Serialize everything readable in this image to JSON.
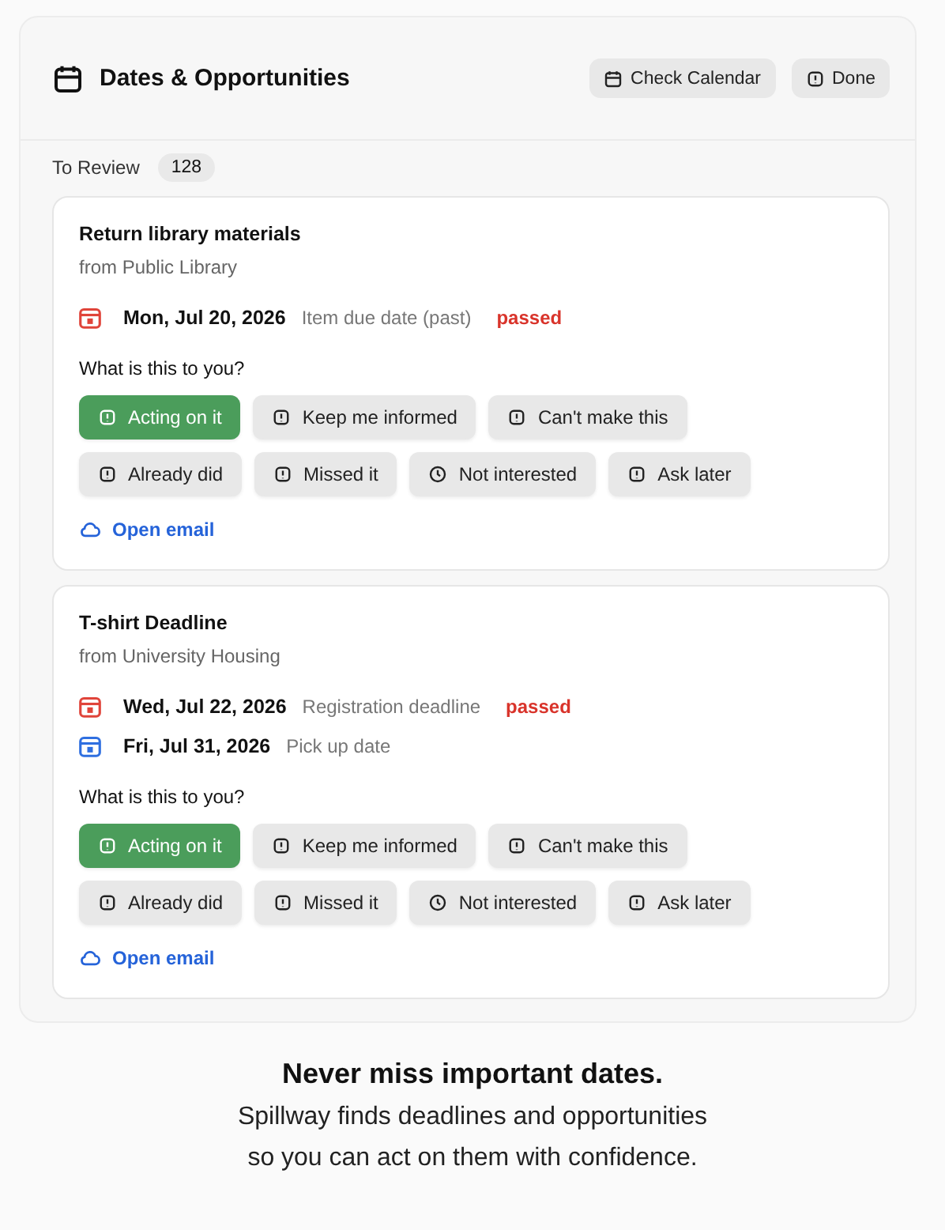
{
  "header": {
    "title": "Dates & Opportunities",
    "actions": [
      {
        "kind": "calendar",
        "label": "Check Calendar"
      },
      {
        "kind": "done",
        "label": "Done"
      }
    ]
  },
  "review": {
    "label": "To Review",
    "count": "128"
  },
  "cards": [
    {
      "title": "Return library materials",
      "source": "from Public Library",
      "dates": [
        {
          "date": "Mon, Jul 20, 2026",
          "description": "Item due date (past)",
          "status": "passed",
          "color": "#e0443a"
        }
      ],
      "question": "What is this to you?",
      "options": [
        {
          "label": "Acting on it",
          "selected": true
        },
        {
          "label": "Keep me informed",
          "selected": false
        },
        {
          "label": "Can't make this",
          "selected": false
        },
        {
          "label": "Already did",
          "selected": false
        },
        {
          "label": "Missed it",
          "selected": false
        },
        {
          "label": "Not interested",
          "selected": false
        },
        {
          "label": "Ask later",
          "selected": false
        }
      ],
      "link": "Open email"
    },
    {
      "title": "T-shirt Deadline",
      "source": "from University Housing",
      "dates": [
        {
          "date": "Wed, Jul 22, 2026",
          "description": "Registration deadline",
          "status": "passed",
          "color": "#e0443a"
        },
        {
          "date": "Fri, Jul 31, 2026",
          "description": "Pick up date",
          "color": "#2f6fe0"
        }
      ],
      "question": "What is this to you?",
      "options": [
        {
          "label": "Acting on it",
          "selected": true
        },
        {
          "label": "Keep me informed",
          "selected": false
        },
        {
          "label": "Can't make this",
          "selected": false
        },
        {
          "label": "Already did",
          "selected": false
        },
        {
          "label": "Missed it",
          "selected": false
        },
        {
          "label": "Not interested",
          "selected": false
        },
        {
          "label": "Ask later",
          "selected": false
        }
      ],
      "link": "Open email"
    }
  ],
  "footer": {
    "headline": "Never miss important dates.",
    "lines": [
      "Spillway finds deadlines and opportunities",
      "so you can act on them with confidence."
    ]
  }
}
